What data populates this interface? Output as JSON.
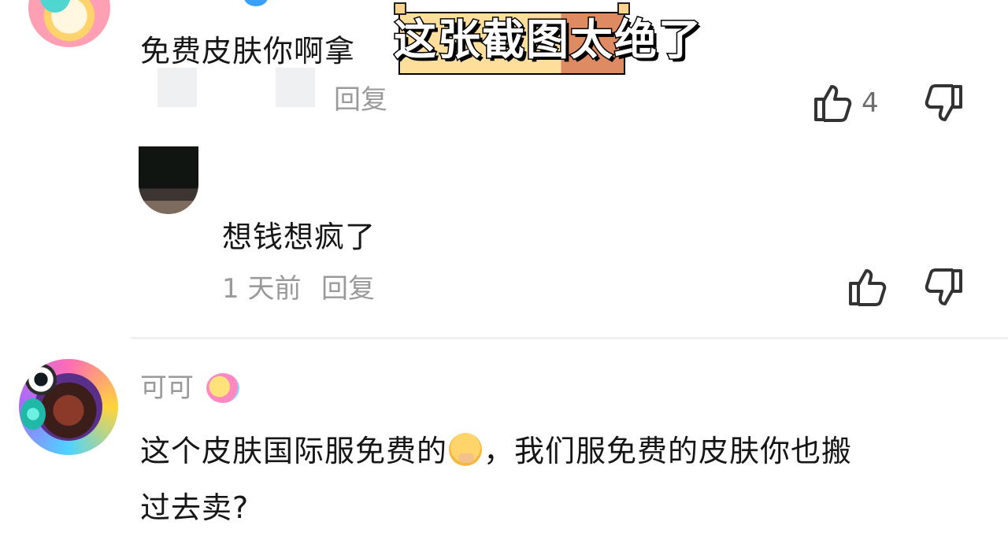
{
  "caption": {
    "text": "这张截图太绝了"
  },
  "comments": [
    {
      "text": "免费皮肤你啊拿",
      "reply_label": "回复",
      "likes": "4"
    },
    {
      "text": "想钱想疯了",
      "time": "1 天前",
      "reply_label": "回复"
    },
    {
      "username": "可可",
      "text_before_emoji": "这个皮肤国际服免费的",
      "text_after_emoji": "，我们服免费的皮肤你也搬",
      "text_line2": "过去卖?"
    }
  ],
  "colors": {
    "primary_text": "#161616",
    "secondary_text": "#9a9a9a",
    "caption_bg": "#ffdf9b",
    "caption_accent": "#de8a62"
  },
  "icons": [
    "thumbs-up-icon",
    "thumbs-down-icon",
    "thinking-face-emoji"
  ]
}
